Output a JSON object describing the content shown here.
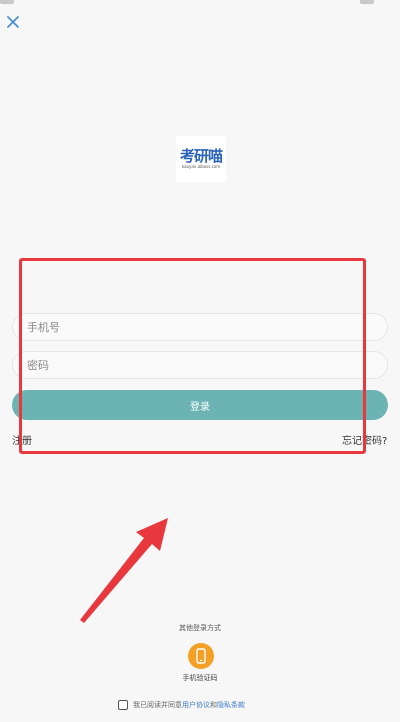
{
  "header": {
    "close_icon": "close-icon"
  },
  "logo": {
    "brand": "考研喵",
    "subtitle": "kaoyan.aiboss.com"
  },
  "form": {
    "phone_placeholder": "手机号",
    "password_placeholder": "密码",
    "login_label": "登录",
    "register_label": "注册",
    "forgot_label": "忘记密码?"
  },
  "other_login": {
    "title": "其他登录方式",
    "phone_code_label": "手机验证码",
    "phone_icon": "phone-icon"
  },
  "agreement": {
    "prefix": "我已阅读并同意",
    "user_agreement": "用户协议",
    "and": "和",
    "privacy_policy": "隐私条款"
  },
  "colors": {
    "accent": "#6cb3b4",
    "highlight": "#e8383d",
    "arrow": "#e8383d",
    "phone_button": "#f4a026",
    "close": "#4a90d9"
  }
}
